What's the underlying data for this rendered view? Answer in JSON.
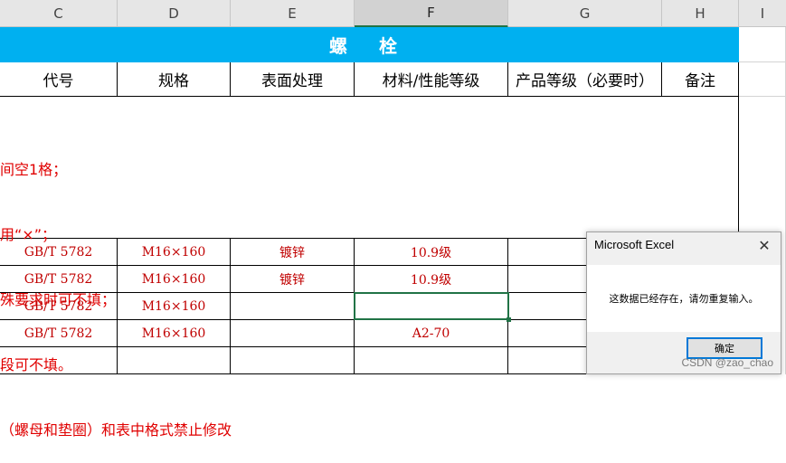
{
  "column_headers": [
    "C",
    "D",
    "E",
    "F",
    "G",
    "H",
    "I"
  ],
  "selected_column": "F",
  "sheet": {
    "title": "螺 栓",
    "headers": [
      "代号",
      "规格",
      "表面处理",
      "材料/性能等级",
      "产品等级（必要时）",
      "备注"
    ],
    "notes": [
      "间空1格；",
      "用“×”；",
      "殊要求时可不填；",
      "段可不填。",
      "（螺母和垫圈）和表中格式禁止修改"
    ],
    "rows": [
      [
        "GB/T 5782",
        "M16×160",
        "镀锌",
        "10.9级",
        "",
        ""
      ],
      [
        "GB/T 5782",
        "M16×160",
        "镀锌",
        "10.9级",
        "",
        ""
      ],
      [
        "GB/T 5782",
        "M16×160",
        "",
        "",
        "",
        ""
      ],
      [
        "GB/T 5782",
        "M16×160",
        "",
        "A2-70",
        "",
        ""
      ],
      [
        "",
        "",
        "",
        "",
        "",
        ""
      ]
    ]
  },
  "dialog": {
    "title": "Microsoft Excel",
    "close_glyph": "✕",
    "message": "这数据已经存在，请勿重复输入。",
    "ok_label": "确定"
  },
  "watermark": "CSDN @zao_chao"
}
